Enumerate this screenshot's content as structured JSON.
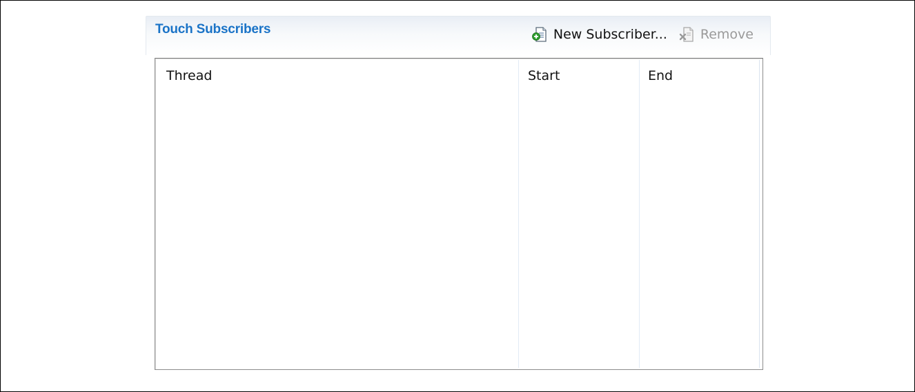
{
  "section": {
    "title": "Touch Subscribers"
  },
  "toolbar": {
    "new_subscriber_label": "New Subscriber...",
    "new_subscriber_icon": "new-item-icon",
    "remove_label": "Remove",
    "remove_icon": "remove-item-icon",
    "remove_enabled": false
  },
  "table": {
    "columns": [
      "Thread",
      "Start",
      "End"
    ],
    "rows": []
  },
  "colors": {
    "title": "#1a73c7",
    "border": "#8c8c8c",
    "disabled_text": "#9a9a9a",
    "add_icon_accent": "#2f9e2f"
  }
}
